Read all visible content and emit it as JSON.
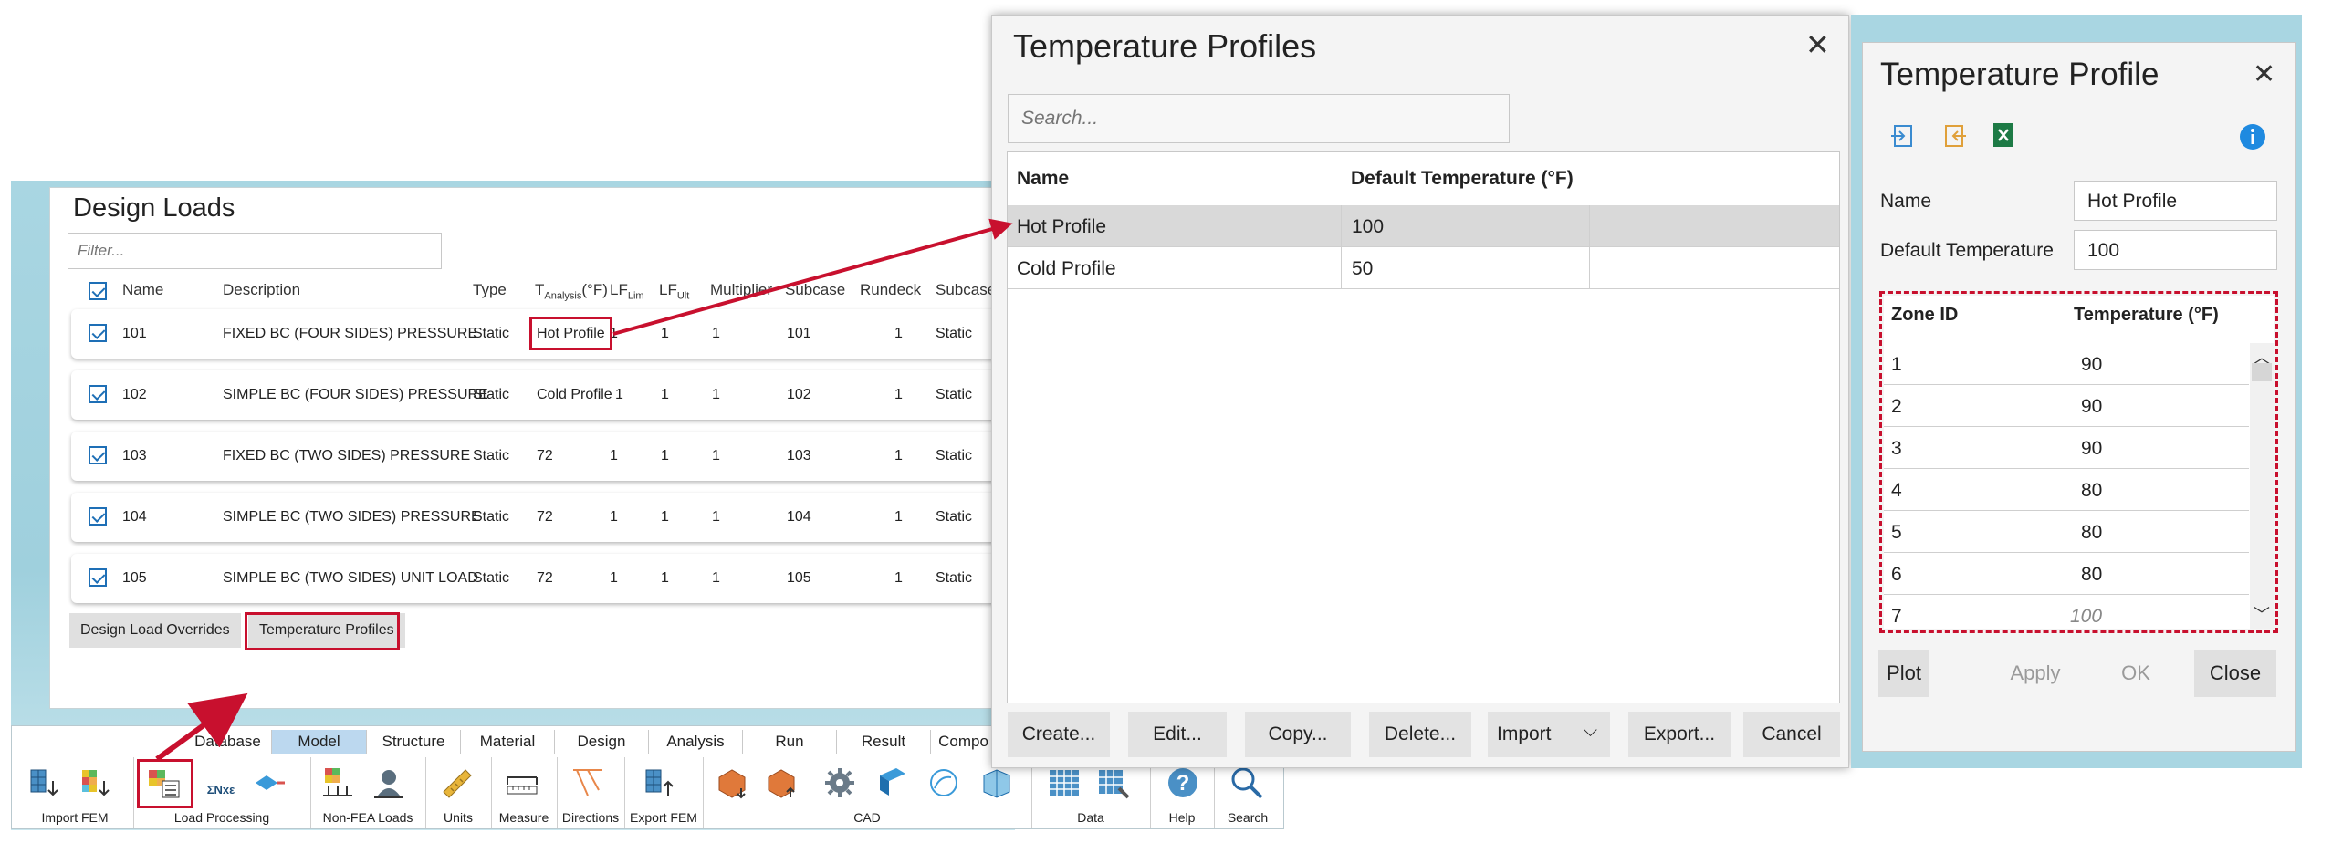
{
  "design_loads": {
    "title": "Design Loads",
    "filter_placeholder": "Filter...",
    "columns": {
      "name": "Name",
      "description": "Description",
      "type": "Type",
      "t_analysis_main": "T",
      "t_analysis_sub": "Analysis",
      "t_analysis_unit": "(°F)",
      "lf_lim_main": "LF",
      "lf_lim_sub": "Lim",
      "lf_ult_main": "LF",
      "lf_ult_sub": "Ult",
      "multiplier": "Multiplier",
      "subcase": "Subcase",
      "rundeck": "Rundeck",
      "subcase2": "Subcase"
    },
    "rows": [
      {
        "name": "101",
        "description": "FIXED BC (FOUR SIDES) PRESSURE",
        "type": "Static",
        "t_analysis": "Hot Profile",
        "lf_lim": "1",
        "lf_ult": "1",
        "multiplier": "1",
        "subcase": "101",
        "rundeck": "1",
        "subcase2": "Static"
      },
      {
        "name": "102",
        "description": "SIMPLE BC (FOUR SIDES) PRESSURE",
        "type": "Static",
        "t_analysis": "Cold Profile",
        "lf_lim": "1",
        "lf_ult": "1",
        "multiplier": "1",
        "subcase": "102",
        "rundeck": "1",
        "subcase2": "Static"
      },
      {
        "name": "103",
        "description": "FIXED BC (TWO SIDES) PRESSURE",
        "type": "Static",
        "t_analysis": "72",
        "lf_lim": "1",
        "lf_ult": "1",
        "multiplier": "1",
        "subcase": "103",
        "rundeck": "1",
        "subcase2": "Static"
      },
      {
        "name": "104",
        "description": "SIMPLE BC (TWO SIDES) PRESSURE",
        "type": "Static",
        "t_analysis": "72",
        "lf_lim": "1",
        "lf_ult": "1",
        "multiplier": "1",
        "subcase": "104",
        "rundeck": "1",
        "subcase2": "Static"
      },
      {
        "name": "105",
        "description": "SIMPLE BC (TWO SIDES) UNIT LOAD",
        "type": "Static",
        "t_analysis": "72",
        "lf_lim": "1",
        "lf_ult": "1",
        "multiplier": "1",
        "subcase": "105",
        "rundeck": "1",
        "subcase2": "Static"
      }
    ],
    "buttons": {
      "overrides": "Design Load Overrides",
      "temperature_profiles": "Temperature Profiles"
    }
  },
  "ribbon": {
    "tabs": [
      "Database",
      "Model",
      "Structure",
      "Material",
      "Design",
      "Analysis",
      "Run",
      "Result",
      "Compo"
    ],
    "active_tab": "Model",
    "groups": [
      "Import FEM",
      "Load Processing",
      "Non-FEA Loads",
      "Units",
      "Measure",
      "Directions",
      "Export FEM",
      "CAD",
      "Data",
      "Help",
      "Search"
    ],
    "icon_text_sum": "ΣNxε"
  },
  "temperature_profiles": {
    "title": "Temperature Profiles",
    "search_placeholder": "Search...",
    "columns": {
      "name": "Name",
      "default_temperature": "Default Temperature (°F)"
    },
    "rows": [
      {
        "name": "Hot Profile",
        "default_temperature": "100"
      },
      {
        "name": "Cold Profile",
        "default_temperature": "50"
      }
    ],
    "buttons": {
      "create": "Create...",
      "edit": "Edit...",
      "copy": "Copy...",
      "delete": "Delete...",
      "import": "Import",
      "export": "Export...",
      "cancel": "Cancel"
    }
  },
  "temperature_profile": {
    "title": "Temperature Profile",
    "name_label": "Name",
    "name_value": "Hot Profile",
    "default_temp_label": "Default Temperature",
    "default_temp_value": "100",
    "zone_columns": {
      "zone_id": "Zone ID",
      "temperature": "Temperature (°F)"
    },
    "zones": [
      {
        "zone_id": "1",
        "temperature": "90"
      },
      {
        "zone_id": "2",
        "temperature": "90"
      },
      {
        "zone_id": "3",
        "temperature": "90"
      },
      {
        "zone_id": "4",
        "temperature": "80"
      },
      {
        "zone_id": "5",
        "temperature": "80"
      },
      {
        "zone_id": "6",
        "temperature": "80"
      },
      {
        "zone_id": "7",
        "temperature": "100"
      }
    ],
    "buttons": {
      "plot": "Plot",
      "apply": "Apply",
      "ok": "OK",
      "close": "Close"
    }
  },
  "colors": {
    "highlight_red": "#c8102e",
    "accent_blue": "#1e6fb6",
    "window_bg": "#a9d6e2",
    "selected_row": "#d9d9d9"
  }
}
